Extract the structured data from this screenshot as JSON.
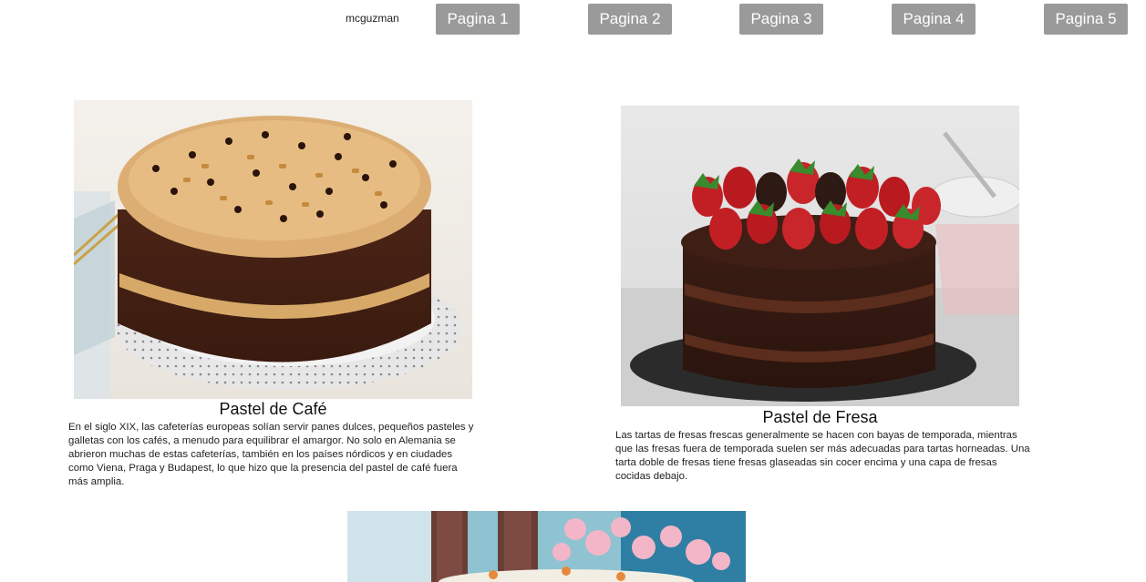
{
  "header": {
    "username": "mcguzman",
    "pages": [
      {
        "label": "Pagina 1"
      },
      {
        "label": "Pagina 2"
      },
      {
        "label": "Pagina 3"
      },
      {
        "label": "Pagina 4"
      },
      {
        "label": "Pagina 5"
      }
    ]
  },
  "cards": [
    {
      "title": "Pastel de Café",
      "text": "En el siglo XIX, las cafeterías europeas solían servir panes dulces, pequeños pasteles y galletas con los cafés, a menudo para equilibrar el amargor. No solo en Alemania se abrieron muchas de estas cafeterías, también en los países nórdicos y en ciudades como Viena, Praga y Budapest, lo que hizo que la presencia del pastel de café fuera más amplia."
    },
    {
      "title": "Pastel de Fresa",
      "text": "Las tartas de fresas frescas generalmente se hacen con bayas de temporada, mientras que las fresas fuera de temporada suelen ser más adecuadas para tartas horneadas. Una tarta doble de fresas tiene fresas glaseadas sin cocer encima y una capa de fresas cocidas debajo."
    }
  ]
}
